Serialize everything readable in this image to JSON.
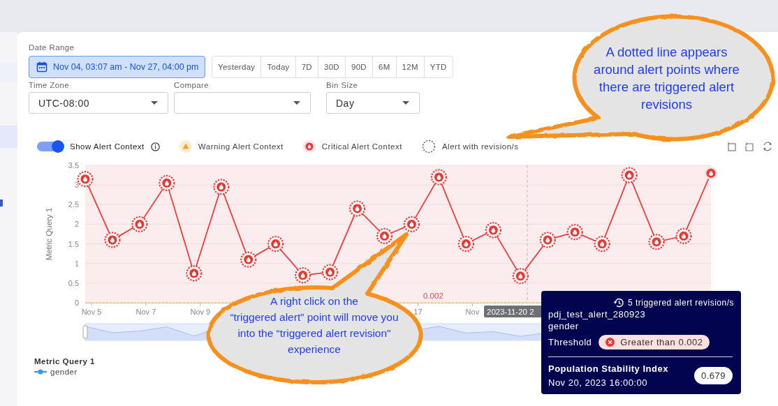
{
  "date_range": {
    "label": "Date Range",
    "value": "Nov 04, 03:07 am - Nov 27, 04:00 pm",
    "selected": true,
    "presets": [
      {
        "label": "Yesterday",
        "selected": false
      },
      {
        "label": "Today",
        "selected": false
      },
      {
        "label": "7D",
        "selected": false
      },
      {
        "label": "30D",
        "selected": false
      },
      {
        "label": "90D",
        "selected": false
      },
      {
        "label": "6M",
        "selected": false
      },
      {
        "label": "12M",
        "selected": false
      },
      {
        "label": "YTD",
        "selected": false
      }
    ]
  },
  "selects": [
    {
      "label": "Time Zone",
      "value": "UTC-08:00"
    },
    {
      "label": "Compare"
    },
    {
      "label": "Bin Size",
      "value": "Day"
    }
  ],
  "legend": {
    "toggle": {
      "label": "Show Alert Context",
      "on": true
    },
    "items": [
      {
        "kind": "warning",
        "label": "Warning Alert Context"
      },
      {
        "kind": "critical",
        "label": "Critical Alert Context"
      },
      {
        "kind": "revision",
        "label": "Alert with revision/s"
      }
    ]
  },
  "chart": {
    "chart_data": {
      "type": "line",
      "ylabel": "Metric Query 1",
      "categories": [
        "Nov 5",
        null,
        "Nov 7",
        null,
        "Nov 9",
        null,
        null,
        null,
        null,
        null,
        null,
        null,
        "17",
        null,
        "Nov",
        null,
        null,
        null,
        null,
        null,
        null,
        null,
        null,
        null
      ],
      "grid": true,
      "series": [
        {
          "name": "gender",
          "color": "#ef3b3b",
          "marker": true,
          "values": [
            3.15,
            1.6,
            2.0,
            3.05,
            0.75,
            2.95,
            1.1,
            1.5,
            0.7,
            0.78,
            2.4,
            1.7,
            2.0,
            3.2,
            1.5,
            1.85,
            0.68,
            1.6,
            1.8,
            1.5,
            3.25,
            1.55,
            1.7,
            3.3
          ]
        }
      ],
      "ylim": [
        0,
        3.5
      ],
      "yticks": [
        0,
        0.5,
        1,
        1.5,
        2,
        2.5,
        3,
        3.5
      ],
      "annotations": [
        {
          "text": "0.002"
        }
      ]
    },
    "markers": [
      {
        "revision": true
      },
      {
        "revision": true
      },
      {
        "revision": true
      },
      {
        "revision": true
      },
      {
        "revision": true
      },
      {
        "revision": true
      },
      {
        "revision": true
      },
      {
        "revision": true
      },
      {
        "revision": true
      },
      {
        "revision": true
      },
      {
        "revision": true
      },
      {
        "revision": true
      },
      {
        "revision": true
      },
      {
        "revision": true
      },
      {
        "revision": true
      },
      {
        "revision": true
      },
      {
        "revision": true
      },
      {
        "revision": true
      },
      {
        "revision": true
      },
      {
        "revision": true
      },
      {
        "revision": true
      },
      {
        "revision": true
      },
      {
        "revision": true
      },
      {
        "revision": false
      }
    ],
    "pointer_label": "2023-11-20 2"
  },
  "series_legend": {
    "title": "Metric Query 1"
  },
  "tooltip": {
    "revisions": "5 triggered alert revision/s",
    "alert": "pdj_test_alert_280923",
    "field": "gender",
    "threshold_label": "Threshold",
    "threshold": "Greater than 0.002",
    "metric": "Population Stability Index",
    "time": "Nov 20, 2023 16:00:00",
    "value": "0.679"
  },
  "callouts": [
    {
      "text": "A dotted line appears\naround alert points where\nthere are triggered alert\nrevisions"
    },
    {
      "text": "A right click on the\n“triggered alert” point will move you\ninto the “triggered alert revision\"\nexperience"
    }
  ]
}
